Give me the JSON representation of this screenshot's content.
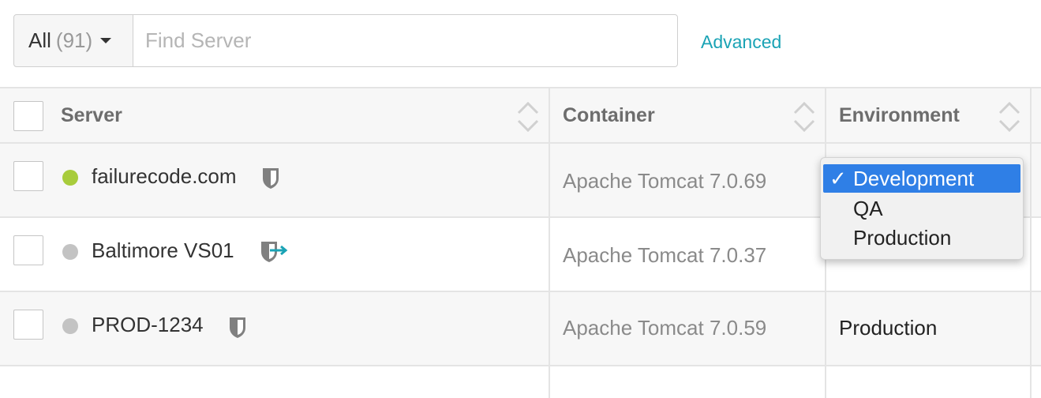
{
  "toolbar": {
    "filter_label": "All",
    "filter_count": "(91)",
    "search_placeholder": "Find Server",
    "advanced_link": "Advanced"
  },
  "table": {
    "columns": [
      "Server",
      "Container",
      "Environment"
    ],
    "rows": [
      {
        "server": "failurecode.com",
        "status_color": "#a8cc3c",
        "container": "Apache Tomcat 7.0.69",
        "environment": "",
        "icon": "shield-icon"
      },
      {
        "server": "Baltimore VS01",
        "status_color": "#c3c3c3",
        "container": "Apache Tomcat 7.0.37",
        "environment": "",
        "icon": "shield-arrow-icon"
      },
      {
        "server": "PROD-1234",
        "status_color": "#c3c3c3",
        "container": "Apache Tomcat 7.0.59",
        "environment": "Production",
        "icon": "shield-icon"
      }
    ]
  },
  "environment_dropdown": {
    "options": [
      "Development",
      "QA",
      "Production"
    ],
    "selected": "Development",
    "check_mark": "✓"
  },
  "colors": {
    "accent": "#1aa3b5",
    "selection": "#2f7fe6",
    "status_online": "#a8cc3c",
    "status_offline": "#c3c3c3"
  }
}
